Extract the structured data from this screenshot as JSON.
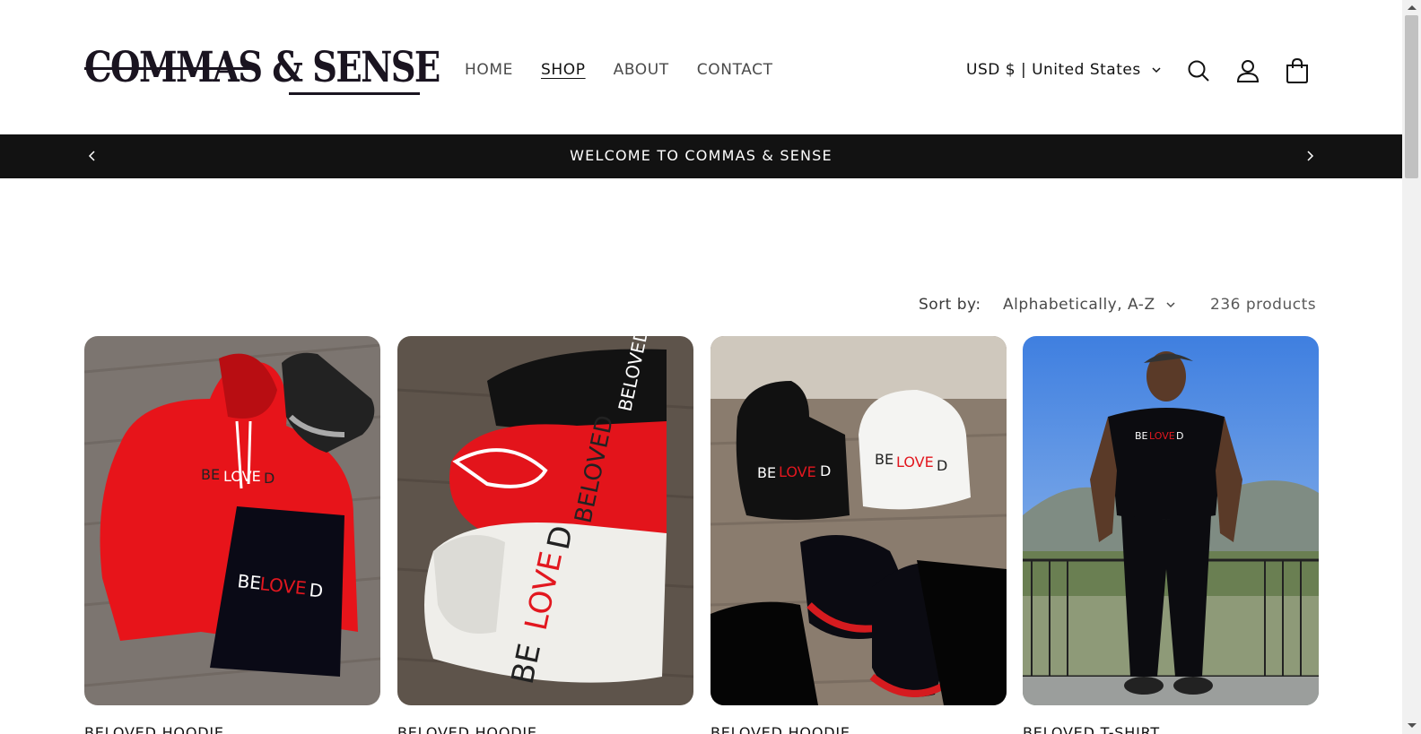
{
  "logo": {
    "alt": "COMMAS & SENSE",
    "text": "COMMAS & SENSE"
  },
  "nav": {
    "items": [
      {
        "label": "HOME",
        "active": false
      },
      {
        "label": "SHOP",
        "active": true
      },
      {
        "label": "ABOUT",
        "active": false
      },
      {
        "label": "CONTACT",
        "active": false
      }
    ]
  },
  "header": {
    "currency": "USD $ | United States",
    "icons": [
      "search-icon",
      "account-icon",
      "cart-icon"
    ]
  },
  "announcement": {
    "text": "WELCOME TO COMMAS & SENSE"
  },
  "collection": {
    "sort_label": "Sort by:",
    "sort_value": "Alphabetically, A-Z",
    "product_count": "236 products"
  },
  "products": [
    {
      "title": "BELOVED HOODIE"
    },
    {
      "title": "BELOVED HOODIE"
    },
    {
      "title": "BELOVED HOODIE"
    },
    {
      "title": "BELOVED T-SHIRT"
    }
  ],
  "colors": {
    "announcement_bg": "#121212",
    "brand_dark": "#1a1420",
    "accent_red": "#e2171f"
  }
}
